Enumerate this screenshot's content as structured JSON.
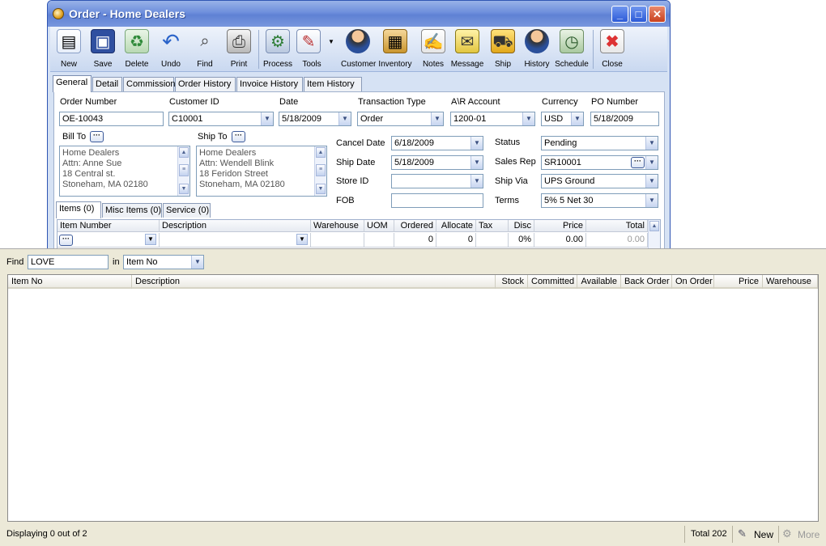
{
  "window": {
    "title": "Order - Home Dealers",
    "minimize": "_",
    "maximize": "□",
    "close": "✕"
  },
  "toolbar": {
    "items": [
      {
        "label": "New",
        "icon": "new-document-icon"
      },
      {
        "label": "Save",
        "icon": "floppy-disk-icon"
      },
      {
        "label": "Delete",
        "icon": "recycle-bin-icon"
      },
      {
        "label": "Undo",
        "icon": "undo-arrow-icon"
      },
      {
        "label": "Find",
        "icon": "binoculars-icon"
      },
      {
        "label": "Print",
        "icon": "printer-icon"
      },
      {
        "label": "Process",
        "icon": "process-icon"
      },
      {
        "label": "Tools",
        "icon": "tools-icon"
      },
      {
        "label": "Customer",
        "icon": "customer-icon"
      },
      {
        "label": "Inventory",
        "icon": "inventory-boxes-icon"
      },
      {
        "label": "Notes",
        "icon": "notes-icon"
      },
      {
        "label": "Message",
        "icon": "message-icon"
      },
      {
        "label": "Ship",
        "icon": "forklift-icon"
      },
      {
        "label": "History",
        "icon": "history-icon"
      },
      {
        "label": "Schedule",
        "icon": "schedule-icon"
      },
      {
        "label": "Close",
        "icon": "close-icon"
      }
    ]
  },
  "tabs": [
    "General",
    "Detail",
    "Commission",
    "Order History",
    "Invoice History",
    "Item History"
  ],
  "form": {
    "order_number_label": "Order Number",
    "order_number": "OE-10043",
    "customer_id_label": "Customer ID",
    "customer_id": "C10001",
    "date_label": "Date",
    "date": "5/18/2009",
    "transaction_type_label": "Transaction Type",
    "transaction_type": "Order",
    "ar_account_label": "A\\R Account",
    "ar_account": "1200-01",
    "currency_label": "Currency",
    "currency": "USD",
    "po_number_label": "PO Number",
    "po_number": "5/18/2009",
    "bill_to_label": "Bill To",
    "bill_to_lines": [
      "Home Dealers",
      "Attn: Anne Sue",
      "18 Central st.",
      "Stoneham, MA 02180"
    ],
    "ship_to_label": "Ship To",
    "ship_to_lines": [
      "Home Dealers",
      "Attn: Wendell Blink",
      "18 Feridon Street",
      "Stoneham, MA 02180"
    ],
    "cancel_date_label": "Cancel  Date",
    "cancel_date": "6/18/2009",
    "ship_date_label": "Ship Date",
    "ship_date": "5/18/2009",
    "store_id_label": "Store ID",
    "store_id": "",
    "fob_label": "FOB",
    "fob": "",
    "status_label": "Status",
    "status": "Pending",
    "sales_rep_label": "Sales Rep",
    "sales_rep": "SR10001",
    "ship_via_label": "Ship Via",
    "ship_via": "UPS Ground",
    "terms_label": "Terms",
    "terms": "5% 5 Net 30"
  },
  "item_tabs": [
    "Items (0)",
    "Misc Items (0)",
    "Service (0)"
  ],
  "item_grid": {
    "headers": [
      "Item Number",
      "Description",
      "Warehouse",
      "UOM",
      "Ordered",
      "Allocate",
      "Tax",
      "Disc",
      "Price",
      "Total"
    ],
    "row": {
      "ordered": "0",
      "allocate": "0",
      "disc": "0%",
      "price": "0.00",
      "total": "0.00"
    }
  },
  "finder": {
    "find_label": "Find",
    "find_value": "LOVE",
    "in_label": "in",
    "in_value": "Item No",
    "headers": [
      "Item No",
      "Description",
      "Stock",
      "Committed",
      "Available",
      "Back Order",
      "On Order",
      "Price",
      "Warehouse"
    ],
    "status_text": "Displaying 0 out of 2",
    "total_text": "Total 202",
    "new_label": "New",
    "more_label": "More"
  }
}
